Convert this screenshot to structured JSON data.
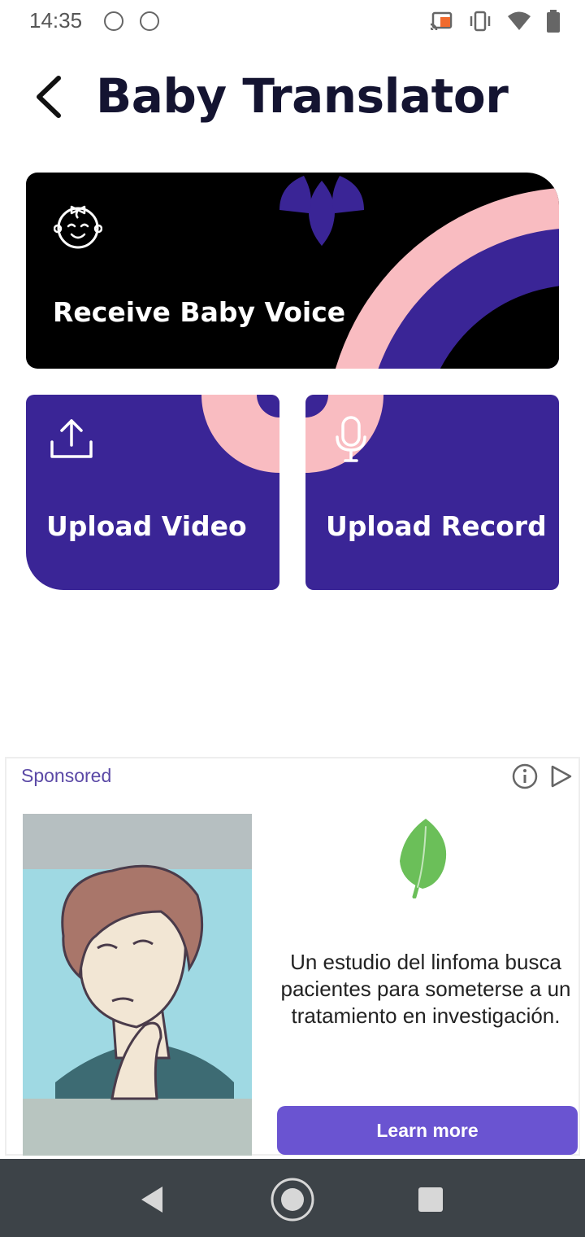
{
  "status": {
    "time": "14:35"
  },
  "header": {
    "title": "Baby Translator"
  },
  "cards": {
    "receive": {
      "label": "Receive Baby Voice"
    },
    "video": {
      "label": "Upload Video"
    },
    "record": {
      "label": "Upload Record"
    }
  },
  "ad": {
    "sponsored_label": "Sponsored",
    "text": "Un estudio del linfoma busca pacientes para someterse a un tratamiento en investigación.",
    "cta_label": "Learn more"
  },
  "colors": {
    "card_dark": "#000000",
    "card_purple": "#3a2596",
    "accent_pink": "#f9bcc1",
    "ad_button": "#6a54d1",
    "leaf_green": "#6bbf59"
  },
  "icons": [
    "back-arrow-icon",
    "baby-face-icon",
    "upload-icon",
    "microphone-icon",
    "info-icon",
    "ad-choices-icon",
    "leaf-icon",
    "nav-back-icon",
    "nav-home-icon",
    "nav-recents-icon"
  ]
}
